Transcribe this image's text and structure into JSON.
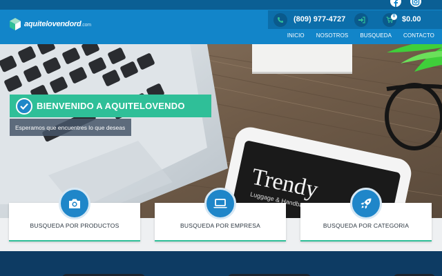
{
  "header": {
    "logo_text": "aquitelovendord",
    "logo_tld": ".com",
    "phone": "(809) 977-4727",
    "cart_count": "0",
    "cart_total": "$0.00"
  },
  "nav": [
    "INICIO",
    "NOSOTROS",
    "BUSQUEDA",
    "CONTACTO"
  ],
  "hero": {
    "title": "BIENVENIDO A AQUITELOVENDO",
    "subtitle": "Esperamos que encuentres lo que deseas",
    "sign_text": "Trendy",
    "sign_sub": "Luggage & Handbag St"
  },
  "cards": [
    {
      "label": "BUSQUEDA POR PRODUCTOS",
      "icon": "camera-icon"
    },
    {
      "label": "BUSQUEDA POR EMPRESA",
      "icon": "laptop-icon"
    },
    {
      "label": "BUSQUEDA POR CATEGORIA",
      "icon": "rocket-icon"
    }
  ],
  "colors": {
    "brand_blue": "#1285c9",
    "dark_blue": "#0b5f94",
    "accent_green": "#2fbf98",
    "footer_navy": "#0d3b63"
  }
}
